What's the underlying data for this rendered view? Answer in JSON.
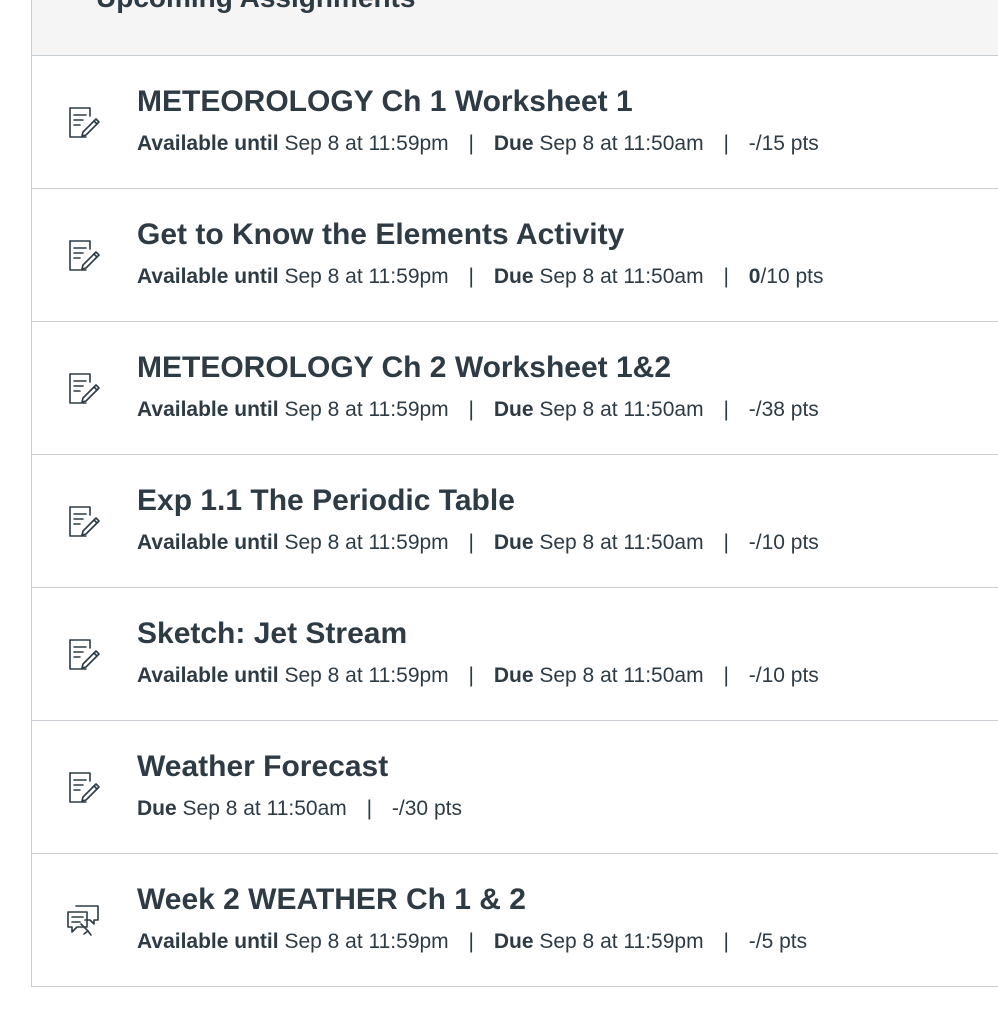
{
  "section": {
    "title": "Upcoming Assignments"
  },
  "assignments": [
    {
      "icon": "assignment-icon",
      "title": "METEOROLOGY Ch 1 Worksheet 1",
      "available_label": "Available until",
      "available_value": "Sep 8 at 11:59pm",
      "due_label": "Due",
      "due_value": "Sep 8 at 11:50am",
      "score": "-",
      "points": "/15 pts"
    },
    {
      "icon": "assignment-icon",
      "title": "Get to Know the Elements Activity",
      "available_label": "Available until",
      "available_value": "Sep 8 at 11:59pm",
      "due_label": "Due",
      "due_value": "Sep 8 at 11:50am",
      "score": "0",
      "points": "/10 pts"
    },
    {
      "icon": "assignment-icon",
      "title": "METEOROLOGY Ch 2 Worksheet 1&2",
      "available_label": "Available until",
      "available_value": "Sep 8 at 11:59pm",
      "due_label": "Due",
      "due_value": "Sep 8 at 11:50am",
      "score": "-",
      "points": "/38 pts"
    },
    {
      "icon": "assignment-icon",
      "title": "Exp 1.1 The Periodic Table",
      "available_label": "Available until",
      "available_value": "Sep 8 at 11:59pm",
      "due_label": "Due",
      "due_value": "Sep 8 at 11:50am",
      "score": "-",
      "points": "/10 pts"
    },
    {
      "icon": "assignment-icon",
      "title": "Sketch: Jet Stream",
      "available_label": "Available until",
      "available_value": "Sep 8 at 11:59pm",
      "due_label": "Due",
      "due_value": "Sep 8 at 11:50am",
      "score": "-",
      "points": "/10 pts"
    },
    {
      "icon": "assignment-icon",
      "title": "Weather Forecast",
      "due_label": "Due",
      "due_value": "Sep 8 at 11:50am",
      "score": "-",
      "points": "/30 pts"
    },
    {
      "icon": "discussion-icon",
      "title": "Week 2 WEATHER Ch 1 & 2",
      "available_label": "Available until",
      "available_value": "Sep 8 at 11:59pm",
      "due_label": "Due",
      "due_value": "Sep 8 at 11:59pm",
      "score": "-",
      "points": "/5 pts"
    }
  ],
  "separator": "|"
}
